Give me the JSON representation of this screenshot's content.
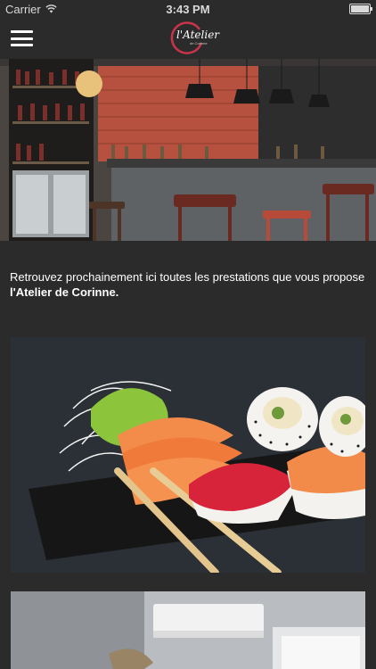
{
  "status_bar": {
    "carrier": "Carrier",
    "time": "3:43 PM",
    "battery_level": 1.0
  },
  "header": {
    "logo_text": "l'Atelier",
    "logo_subtext": "de Corinne",
    "menu_icon": "hamburger-icon"
  },
  "intro": {
    "text": "Retrouvez prochainement ici toutes les prestations que vous propose ",
    "highlight": "l'Atelier de Corinne."
  },
  "colors": {
    "background": "#2b2b2b",
    "logo_ring": "#c8344a",
    "text": "#ffffff"
  }
}
